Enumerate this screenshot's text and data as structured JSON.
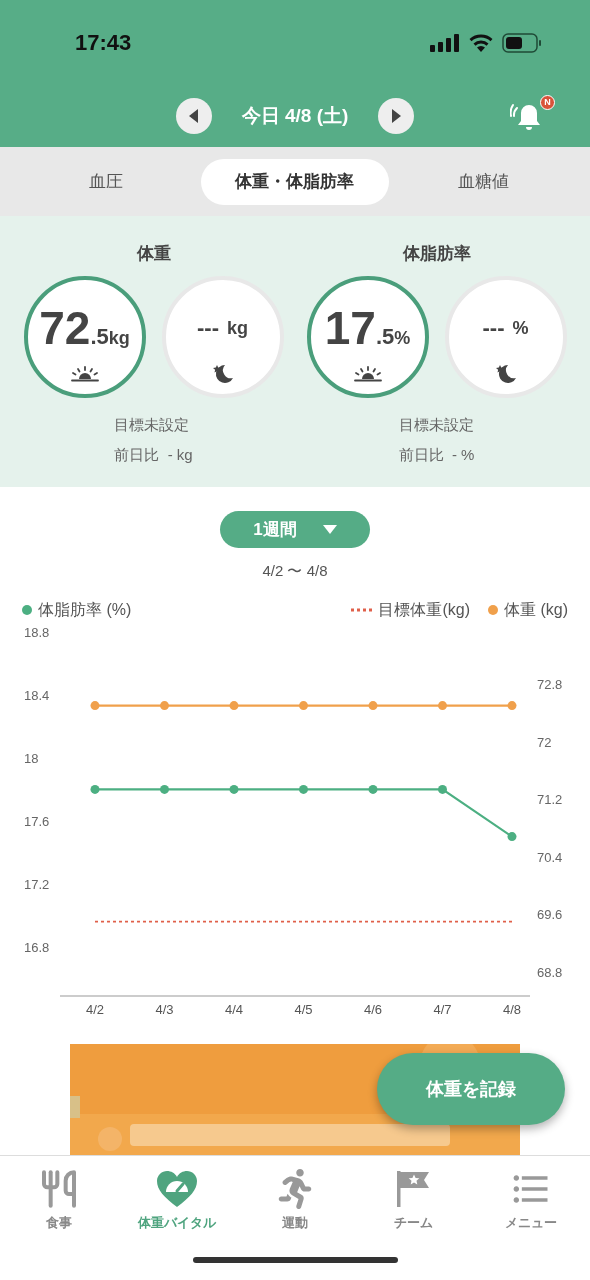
{
  "status_bar": {
    "time": "17:43"
  },
  "header": {
    "date": "今日 4/8 (土)",
    "notification_badge": "N"
  },
  "tabs": [
    {
      "label": "血圧",
      "selected": false
    },
    {
      "label": "体重・体脂肪率",
      "selected": true
    },
    {
      "label": "血糖値",
      "selected": false
    }
  ],
  "metrics": [
    {
      "title": "体重",
      "readings": [
        {
          "kind": "morning",
          "recorded": true,
          "value": "72",
          "decimal": ".5",
          "unit": "kg"
        },
        {
          "kind": "evening",
          "recorded": false,
          "value": "---",
          "unit": "kg"
        }
      ],
      "goal": "目標未設定",
      "change": "前日比  - kg"
    },
    {
      "title": "体脂肪率",
      "readings": [
        {
          "kind": "morning",
          "recorded": true,
          "value": "17",
          "decimal": ".5",
          "unit": "%"
        },
        {
          "kind": "evening",
          "recorded": false,
          "value": "---",
          "unit": "%"
        }
      ],
      "goal": "目標未設定",
      "change": "前日比  - %"
    }
  ],
  "period": {
    "label": "1週間",
    "range": "4/2 〜 4/8"
  },
  "chart_data": {
    "type": "line",
    "categories": [
      "4/2",
      "4/3",
      "4/4",
      "4/5",
      "4/6",
      "4/7",
      "4/8"
    ],
    "series": [
      {
        "name": "体脂肪率 (%)",
        "color": "#4caf82",
        "marker": true,
        "values": [
          17.8,
          17.8,
          17.8,
          17.8,
          17.8,
          17.8,
          17.5
        ]
      },
      {
        "name": "体重 (kg)",
        "color": "#f0a04b",
        "axis": "y2",
        "marker": true,
        "values": [
          72.5,
          72.5,
          72.5,
          72.5,
          72.5,
          72.5,
          72.5
        ]
      }
    ],
    "ref_lines": [
      {
        "label": "目標体重(kg)",
        "color": "#e0604a",
        "axis": "y2",
        "value": 69.5
      }
    ],
    "ylim": [
      16.5,
      18.8
    ],
    "yticks": [
      18.8,
      18.4,
      18,
      17.6,
      17.2,
      16.8
    ],
    "y2lim": [
      68.8,
      72.8
    ],
    "y2ticks": [
      72.8,
      72,
      71.2,
      70.4,
      69.6,
      68.8
    ]
  },
  "record_button": {
    "label": "体重を記録"
  },
  "bottom_nav": [
    {
      "kind": "meal",
      "label": "食事",
      "selected": false
    },
    {
      "kind": "vital",
      "label": "体重バイタル",
      "selected": true
    },
    {
      "kind": "exercise",
      "label": "運動",
      "selected": false
    },
    {
      "kind": "team",
      "label": "チーム",
      "selected": false
    },
    {
      "kind": "menu",
      "label": "メニュー",
      "selected": false
    }
  ]
}
